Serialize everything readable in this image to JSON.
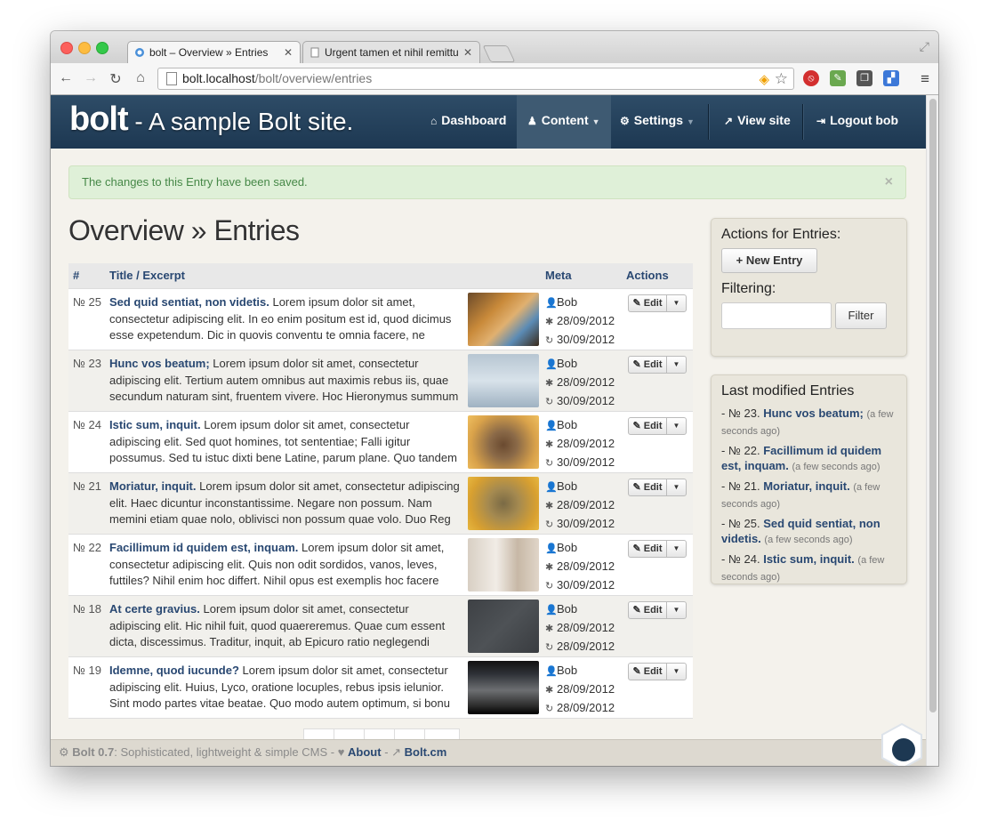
{
  "browser": {
    "tabs": [
      {
        "title": "bolt – Overview » Entries",
        "active": true
      },
      {
        "title": "Urgent tamen et nihil remittu",
        "active": false
      }
    ],
    "url_host": "bolt.localhost",
    "url_path": "/bolt/overview/entries"
  },
  "navbar": {
    "brand_logo": "bolt",
    "brand_site": " - A sample Bolt site.",
    "items": [
      {
        "label": "Dashboard",
        "icon": "home-icon"
      },
      {
        "label": "Content",
        "icon": "sitemap-icon"
      },
      {
        "label": "Settings",
        "icon": "cogs-icon"
      },
      {
        "label": "View site",
        "icon": "external-link-icon"
      },
      {
        "label": "Logout bob",
        "icon": "sign-out-icon"
      }
    ]
  },
  "alert": {
    "message": "The changes to this Entry have been saved.",
    "close": "×"
  },
  "page_title": "Overview » Entries",
  "table": {
    "headers": {
      "num": "#",
      "title": "Title / Excerpt",
      "meta": "Meta",
      "actions": "Actions"
    },
    "edit_label": "Edit",
    "rows": [
      {
        "num": "№ 25",
        "title": "Sed quid sentiat, non videtis.",
        "excerpt": " Lorem ipsum dolor sit amet, consectetur adipiscing elit. In eo enim positum est id, quod dicimus esse expetendum. Dic in quovis conventu te omnia facere, ne doleas. Et",
        "author": "Bob",
        "created": "28/09/2012",
        "modified": "30/09/2012",
        "thumb": "monkeys"
      },
      {
        "num": "№ 23",
        "title": "Hunc vos beatum;",
        "excerpt": " Lorem ipsum dolor sit amet, consectetur adipiscing elit. Tertium autem omnibus aut maximis rebus iis, quae secundum naturam sint, fruentem vivere. Hoc Hieronymus summum bonu",
        "author": "Bob",
        "created": "28/09/2012",
        "modified": "30/09/2012",
        "thumb": "bird-on-ice"
      },
      {
        "num": "№ 24",
        "title": "Istic sum, inquit.",
        "excerpt": " Lorem ipsum dolor sit amet, consectetur adipiscing elit. Sed quot homines, tot sententiae; Falli igitur possumus. Sed tu istuc dixti bene Latine, parum plane. Quo tandem modo? Duo Re",
        "author": "Bob",
        "created": "28/09/2012",
        "modified": "30/09/2012",
        "thumb": "deer"
      },
      {
        "num": "№ 21",
        "title": "Moriatur, inquit.",
        "excerpt": " Lorem ipsum dolor sit amet, consectetur adipiscing elit. Haec dicuntur inconstantissime. Negare non possum. Nam memini etiam quae nolo, oblivisci non possum quae volo. Duo Reg",
        "author": "Bob",
        "created": "28/09/2012",
        "modified": "30/09/2012",
        "thumb": "owl"
      },
      {
        "num": "№ 22",
        "title": "Facillimum id quidem est, inquam.",
        "excerpt": " Lorem ipsum dolor sit amet, consectetur adipiscing elit. Quis non odit sordidos, vanos, leves, futtiles? Nihil enim hoc differt. Nihil opus est exemplis hoc facere longi",
        "author": "Bob",
        "created": "28/09/2012",
        "modified": "30/09/2012",
        "thumb": "penguins"
      },
      {
        "num": "№ 18",
        "title": "At certe gravius.",
        "excerpt": " Lorem ipsum dolor sit amet, consectetur adipiscing elit. Hic nihil fuit, quod quaereremus. Quae cum essent dicta, discessimus. Traditur, inquit, ab Epicuro ratio neglegendi doloris. Qu",
        "author": "Bob",
        "created": "28/09/2012",
        "modified": "28/09/2012",
        "thumb": "slate"
      },
      {
        "num": "№ 19",
        "title": "Idemne, quod iucunde?",
        "excerpt": " Lorem ipsum dolor sit amet, consectetur adipiscing elit. Huius, Lyco, oratione locuples, rebus ipsis ielunior. Sint modo partes vitae beatae. Quo modo autem optimum, si bonu",
        "author": "Bob",
        "created": "28/09/2012",
        "modified": "28/09/2012",
        "thumb": "battle"
      }
    ]
  },
  "sidebar": {
    "actions_title": "Actions for Entries:",
    "new_entry": "+ New Entry",
    "filtering_label": "Filtering:",
    "filter_value": "",
    "filter_button": "Filter",
    "recent_title": "Last modified Entries",
    "recent": [
      {
        "prefix": "- № 23.",
        "title": "Hunc vos beatum;",
        "when": "(a few seconds ago)"
      },
      {
        "prefix": "- № 22.",
        "title": "Facillimum id quidem est, inquam.",
        "when": "(a few seconds ago)"
      },
      {
        "prefix": "- № 21.",
        "title": "Moriatur, inquit.",
        "when": "(a few seconds ago)"
      },
      {
        "prefix": "- № 25.",
        "title": "Sed quid sentiat, non videtis.",
        "when": "(a few seconds ago)"
      },
      {
        "prefix": "- № 24.",
        "title": "Istic sum, inquit.",
        "when": "(a few seconds ago)"
      }
    ]
  },
  "footer": {
    "version": "Bolt 0.7",
    "tagline": ": Sophisticated, lightweight & simple CMS - ",
    "about": "About",
    "sep": " - ",
    "site": "Bolt.cm"
  },
  "colors": {
    "nav": "#1d3852",
    "link": "#294872",
    "alert_bg": "#dff0d8",
    "alert_text": "#468847"
  }
}
